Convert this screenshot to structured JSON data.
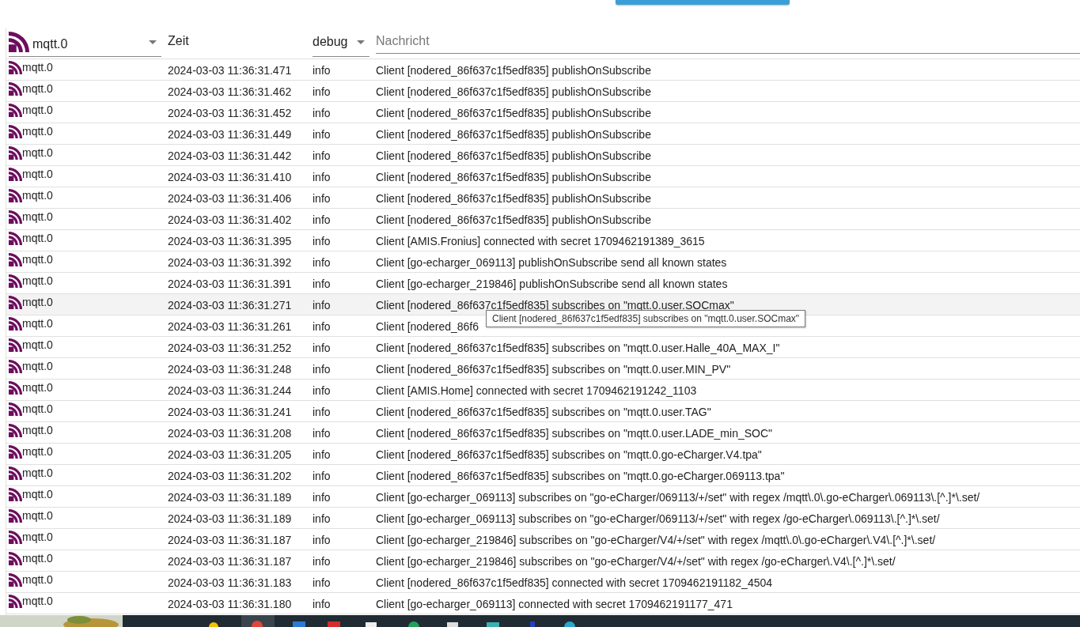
{
  "filters": {
    "source": "mqtt.0",
    "time_label": "Zeit",
    "level": "debug",
    "message_placeholder": "Nachricht"
  },
  "rows": [
    {
      "source": "mqtt.0",
      "time": "2024-03-03 11:36:31.471",
      "level": "info",
      "message": "Client [nodered_86f637c1f5edf835] publishOnSubscribe",
      "hovered": false
    },
    {
      "source": "mqtt.0",
      "time": "2024-03-03 11:36:31.462",
      "level": "info",
      "message": "Client [nodered_86f637c1f5edf835] publishOnSubscribe",
      "hovered": false
    },
    {
      "source": "mqtt.0",
      "time": "2024-03-03 11:36:31.452",
      "level": "info",
      "message": "Client [nodered_86f637c1f5edf835] publishOnSubscribe",
      "hovered": false
    },
    {
      "source": "mqtt.0",
      "time": "2024-03-03 11:36:31.449",
      "level": "info",
      "message": "Client [nodered_86f637c1f5edf835] publishOnSubscribe",
      "hovered": false
    },
    {
      "source": "mqtt.0",
      "time": "2024-03-03 11:36:31.442",
      "level": "info",
      "message": "Client [nodered_86f637c1f5edf835] publishOnSubscribe",
      "hovered": false
    },
    {
      "source": "mqtt.0",
      "time": "2024-03-03 11:36:31.410",
      "level": "info",
      "message": "Client [nodered_86f637c1f5edf835] publishOnSubscribe",
      "hovered": false
    },
    {
      "source": "mqtt.0",
      "time": "2024-03-03 11:36:31.406",
      "level": "info",
      "message": "Client [nodered_86f637c1f5edf835] publishOnSubscribe",
      "hovered": false
    },
    {
      "source": "mqtt.0",
      "time": "2024-03-03 11:36:31.402",
      "level": "info",
      "message": "Client [nodered_86f637c1f5edf835] publishOnSubscribe",
      "hovered": false
    },
    {
      "source": "mqtt.0",
      "time": "2024-03-03 11:36:31.395",
      "level": "info",
      "message": "Client [AMIS.Fronius] connected with secret 1709462191389_3615",
      "hovered": false
    },
    {
      "source": "mqtt.0",
      "time": "2024-03-03 11:36:31.392",
      "level": "info",
      "message": "Client [go-echarger_069113] publishOnSubscribe send all known states",
      "hovered": false
    },
    {
      "source": "mqtt.0",
      "time": "2024-03-03 11:36:31.391",
      "level": "info",
      "message": "Client [go-echarger_219846] publishOnSubscribe send all known states",
      "hovered": false
    },
    {
      "source": "mqtt.0",
      "time": "2024-03-03 11:36:31.271",
      "level": "info",
      "message": "Client [nodered_86f637c1f5edf835] subscribes on \"mqtt.0.user.SOCmax\"",
      "hovered": true
    },
    {
      "source": "mqtt.0",
      "time": "2024-03-03 11:36:31.261",
      "level": "info",
      "message": "Client [nodered_86f6",
      "hovered": false
    },
    {
      "source": "mqtt.0",
      "time": "2024-03-03 11:36:31.252",
      "level": "info",
      "message": "Client [nodered_86f637c1f5edf835] subscribes on \"mqtt.0.user.Halle_40A_MAX_I\"",
      "hovered": false
    },
    {
      "source": "mqtt.0",
      "time": "2024-03-03 11:36:31.248",
      "level": "info",
      "message": "Client [nodered_86f637c1f5edf835] subscribes on \"mqtt.0.user.MIN_PV\"",
      "hovered": false
    },
    {
      "source": "mqtt.0",
      "time": "2024-03-03 11:36:31.244",
      "level": "info",
      "message": "Client [AMIS.Home] connected with secret 1709462191242_1103",
      "hovered": false
    },
    {
      "source": "mqtt.0",
      "time": "2024-03-03 11:36:31.241",
      "level": "info",
      "message": "Client [nodered_86f637c1f5edf835] subscribes on \"mqtt.0.user.TAG\"",
      "hovered": false
    },
    {
      "source": "mqtt.0",
      "time": "2024-03-03 11:36:31.208",
      "level": "info",
      "message": "Client [nodered_86f637c1f5edf835] subscribes on \"mqtt.0.user.LADE_min_SOC\"",
      "hovered": false
    },
    {
      "source": "mqtt.0",
      "time": "2024-03-03 11:36:31.205",
      "level": "info",
      "message": "Client [nodered_86f637c1f5edf835] subscribes on \"mqtt.0.go-eCharger.V4.tpa\"",
      "hovered": false
    },
    {
      "source": "mqtt.0",
      "time": "2024-03-03 11:36:31.202",
      "level": "info",
      "message": "Client [nodered_86f637c1f5edf835] subscribes on \"mqtt.0.go-eCharger.069113.tpa\"",
      "hovered": false
    },
    {
      "source": "mqtt.0",
      "time": "2024-03-03 11:36:31.189",
      "level": "info",
      "message": "Client [go-echarger_069113] subscribes on \"go-eCharger/069113/+/set\" with regex /mqtt\\.0\\.go-eCharger\\.069113\\.[^.]*\\.set/",
      "hovered": false
    },
    {
      "source": "mqtt.0",
      "time": "2024-03-03 11:36:31.189",
      "level": "info",
      "message": "Client [go-echarger_069113] subscribes on \"go-eCharger/069113/+/set\" with regex /go-eCharger\\.069113\\.[^.]*\\.set/",
      "hovered": false
    },
    {
      "source": "mqtt.0",
      "time": "2024-03-03 11:36:31.187",
      "level": "info",
      "message": "Client [go-echarger_219846] subscribes on \"go-eCharger/V4/+/set\" with regex /mqtt\\.0\\.go-eCharger\\.V4\\.[^.]*\\.set/",
      "hovered": false
    },
    {
      "source": "mqtt.0",
      "time": "2024-03-03 11:36:31.187",
      "level": "info",
      "message": "Client [go-echarger_219846] subscribes on \"go-eCharger/V4/+/set\" with regex /go-eCharger\\.V4\\.[^.]*\\.set/",
      "hovered": false
    },
    {
      "source": "mqtt.0",
      "time": "2024-03-03 11:36:31.183",
      "level": "info",
      "message": "Client [nodered_86f637c1f5edf835] connected with secret 1709462191182_4504",
      "hovered": false
    },
    {
      "source": "mqtt.0",
      "time": "2024-03-03 11:36:31.180",
      "level": "info",
      "message": "Client [go-echarger_069113] connected with secret 1709462191177_471",
      "hovered": false
    }
  ],
  "tooltip": "Client [nodered_86f637c1f5edf835] subscribes on \"mqtt.0.user.SOCmax\""
}
